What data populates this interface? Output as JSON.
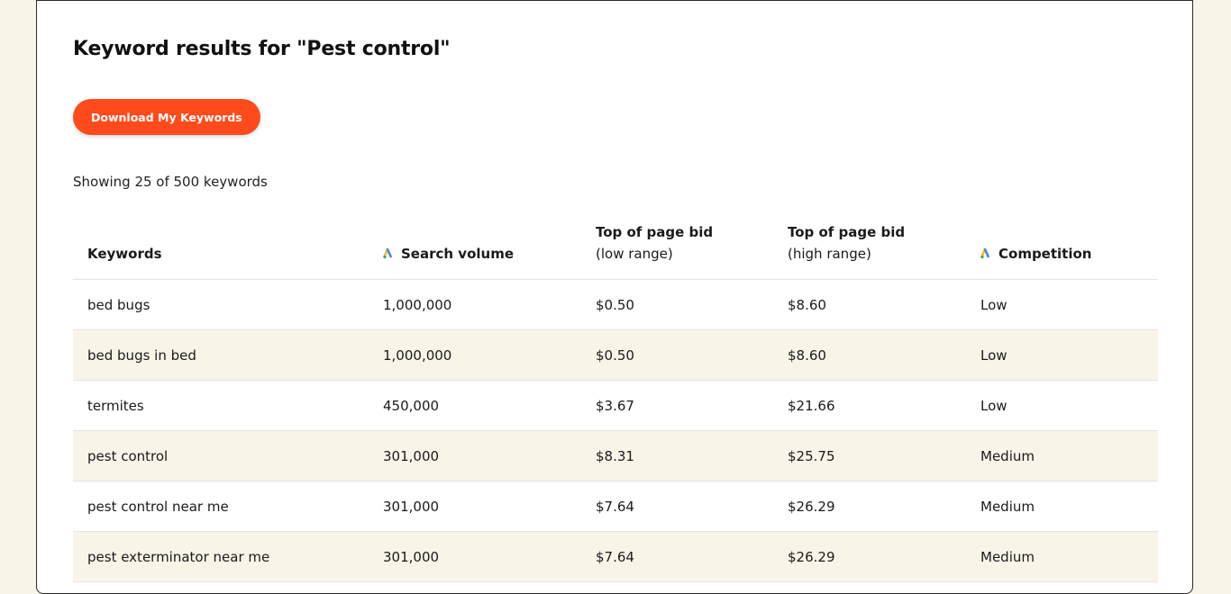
{
  "header": {
    "title": "Keyword results for \"Pest control\""
  },
  "actions": {
    "download_label": "Download My Keywords"
  },
  "summary": {
    "showing_text": "Showing 25 of 500 keywords"
  },
  "table": {
    "headers": {
      "keywords": "Keywords",
      "search_volume": "Search volume",
      "low_bid_line1": "Top of page bid",
      "low_bid_line2": "(low range)",
      "high_bid_line1": "Top of page bid",
      "high_bid_line2": "(high range)",
      "competition": "Competition"
    },
    "header_icons": {
      "search_volume": "google-ads-icon",
      "competition": "google-ads-icon"
    },
    "rows": [
      {
        "keyword": "bed bugs",
        "volume": "1,000,000",
        "low": "$0.50",
        "high": "$8.60",
        "competition": "Low"
      },
      {
        "keyword": "bed bugs in bed",
        "volume": "1,000,000",
        "low": "$0.50",
        "high": "$8.60",
        "competition": "Low"
      },
      {
        "keyword": "termites",
        "volume": "450,000",
        "low": "$3.67",
        "high": "$21.66",
        "competition": "Low"
      },
      {
        "keyword": "pest control",
        "volume": "301,000",
        "low": "$8.31",
        "high": "$25.75",
        "competition": "Medium"
      },
      {
        "keyword": "pest control near me",
        "volume": "301,000",
        "low": "$7.64",
        "high": "$26.29",
        "competition": "Medium"
      },
      {
        "keyword": "pest exterminator near me",
        "volume": "301,000",
        "low": "$7.64",
        "high": "$26.29",
        "competition": "Medium"
      }
    ]
  },
  "colors": {
    "page_background": "#f8f4e8",
    "card_background": "#ffffff",
    "button_accent": "#ff4a1c",
    "alt_row": "#f8f4e8",
    "ads_blue": "#4285f4",
    "ads_yellow": "#fbbc04",
    "ads_green": "#34a853"
  }
}
